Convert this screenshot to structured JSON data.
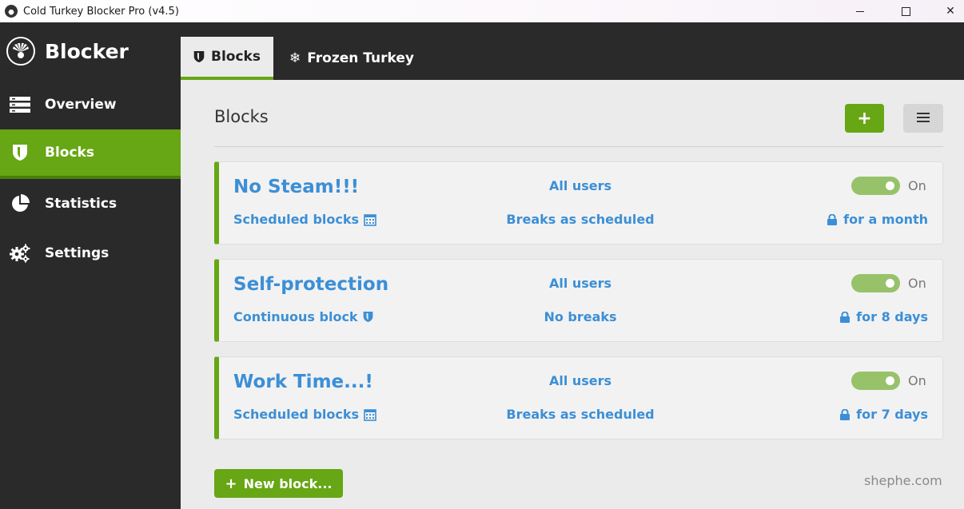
{
  "window": {
    "title": "Cold Turkey Blocker Pro (v4.5)",
    "controls": {
      "minimize_icon": "minimize-icon",
      "maximize_icon": "maximize-icon",
      "close_icon": "close-icon",
      "close_glyph": "✕"
    }
  },
  "sidebar": {
    "brand": "Blocker",
    "items": [
      {
        "label": "Overview",
        "icon": "overview-icon",
        "active": false
      },
      {
        "label": "Blocks",
        "icon": "shield-icon",
        "active": true
      },
      {
        "label": "Statistics",
        "icon": "pie-chart-icon",
        "active": false
      },
      {
        "label": "Settings",
        "icon": "gears-icon",
        "active": false
      }
    ]
  },
  "tabs": [
    {
      "label": "Blocks",
      "icon": "shield-icon",
      "active": true
    },
    {
      "label": "Frozen Turkey",
      "icon": "snowflake-icon",
      "active": false,
      "glyph": "❄"
    }
  ],
  "main": {
    "title": "Blocks",
    "add_glyph": "+",
    "blocks": [
      {
        "name": "No Steam!!!",
        "users": "All users",
        "enabled_label": "On",
        "type": "Scheduled blocks",
        "type_icon": "calendar-icon",
        "breaks": "Breaks as scheduled",
        "lock": "for a month"
      },
      {
        "name": "Self-protection",
        "users": "All users",
        "enabled_label": "On",
        "type": "Continuous block",
        "type_icon": "shield-icon",
        "breaks": "No breaks",
        "lock": "for 8 days"
      },
      {
        "name": "Work Time...!",
        "users": "All users",
        "enabled_label": "On",
        "type": "Scheduled blocks",
        "type_icon": "calendar-icon",
        "breaks": "Breaks as scheduled",
        "lock": "for 7 days"
      }
    ],
    "new_block_label": "New block...",
    "new_block_glyph": "+"
  },
  "watermark": "shephe.com",
  "colors": {
    "accent": "#67a614",
    "link": "#3c8fd6",
    "sidebar_bg": "#2a2a2a",
    "toggle_on": "#97c26a"
  }
}
